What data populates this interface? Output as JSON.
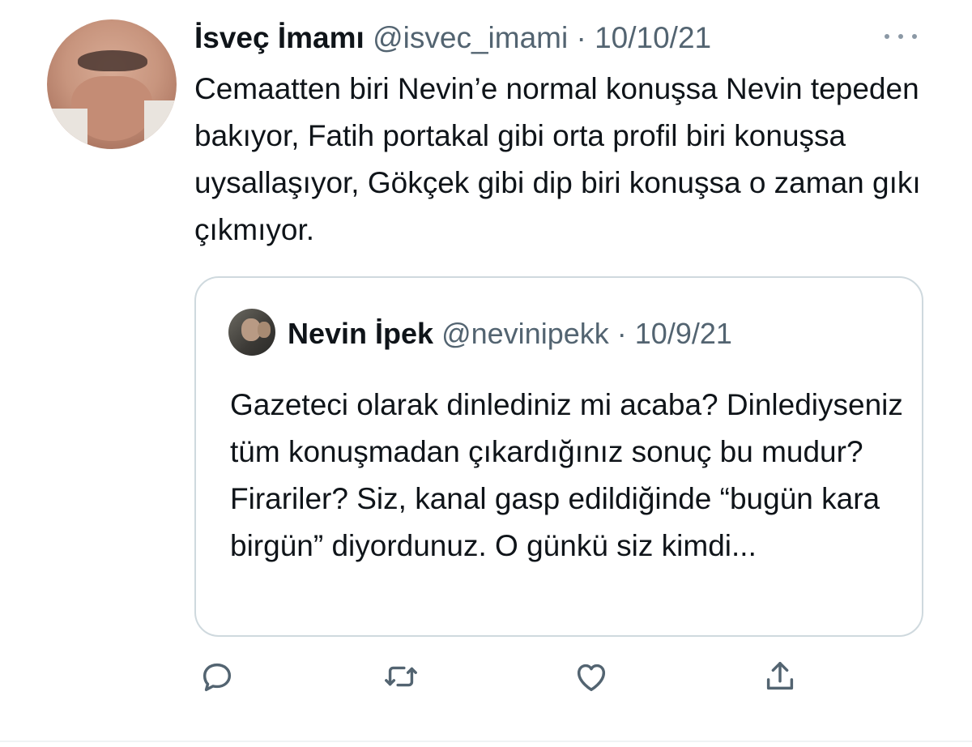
{
  "tweet": {
    "author": {
      "display_name": "İsveç İmamı",
      "handle": "@isvec_imami"
    },
    "separator": "·",
    "date": "10/10/21",
    "text": "Cemaatten biri Nevin’e normal konuşsa Nevin tepeden bakıyor, Fatih portakal gibi orta profil biri konuşsa uysallaşıyor, Gökçek gibi dip biri konuşsa o zaman gıkı çıkmıyor.",
    "more_icon": "ellipsis-icon"
  },
  "quoted_tweet": {
    "author": {
      "display_name": "Nevin İpek",
      "handle": "@nevinipekk"
    },
    "separator": "·",
    "date": "10/9/21",
    "text": "Gazeteci olarak dinlediniz mi acaba? Dinlediyseniz tüm konuşmadan çıkardığınız sonuç bu mudur? Firariler? Siz, kanal gasp edildiğinde “bugün kara birgün” diyordunuz. O günkü siz kimdi..."
  },
  "actions": [
    {
      "icon": "reply-icon"
    },
    {
      "icon": "retweet-icon"
    },
    {
      "icon": "like-icon"
    },
    {
      "icon": "share-icon"
    }
  ],
  "colors": {
    "text_primary": "#0f1419",
    "text_secondary": "#536471",
    "border": "#cfd9de",
    "icon": "#536471"
  }
}
